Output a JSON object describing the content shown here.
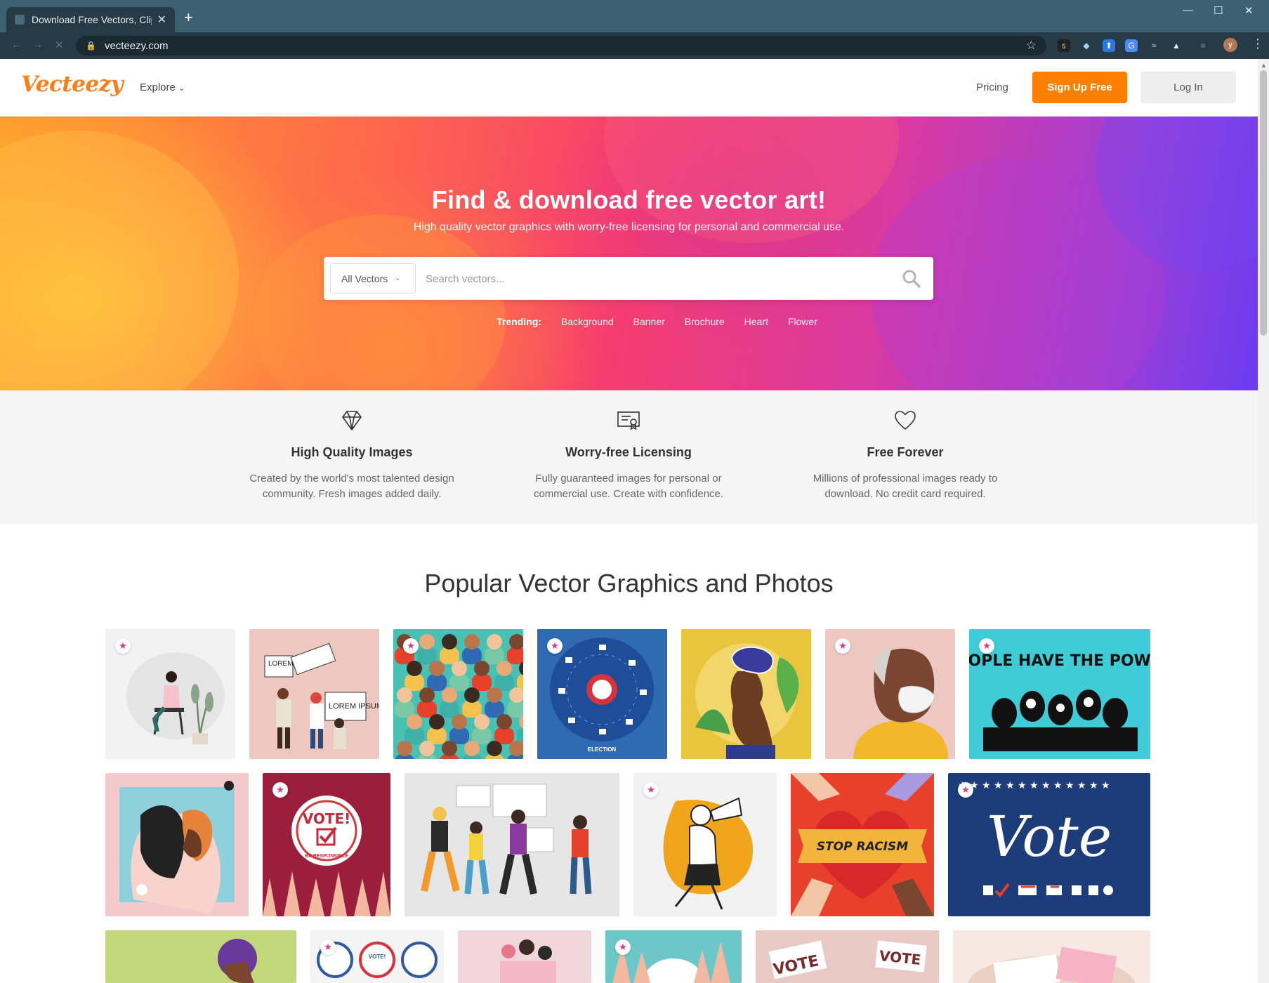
{
  "browser": {
    "tab_title": "Download Free Vectors, Clipar",
    "url": "vecteezy.com",
    "new_tab": "+",
    "tab_close": "✕",
    "profile_initial": "y",
    "window_controls": {
      "minimize": "—",
      "maximize": "☐",
      "close": "✕"
    },
    "extension_badge": "5",
    "icons": [
      "lock-icon",
      "star-icon",
      "extension-icons",
      "profile-avatar",
      "menu-icon"
    ]
  },
  "header": {
    "logo": "Vecteezy",
    "explore": "Explore",
    "explore_chevron": "⌄",
    "pricing": "Pricing",
    "signup": "Sign Up Free",
    "login": "Log In"
  },
  "hero": {
    "title": "Find & download free vector art!",
    "subtitle": "High quality vector graphics with worry-free licensing for personal and commercial use.",
    "search": {
      "category": "All Vectors",
      "placeholder": "Search vectors..."
    },
    "trending_label": "Trending:",
    "trending": [
      "Background",
      "Banner",
      "Brochure",
      "Heart",
      "Flower"
    ]
  },
  "features": [
    {
      "icon": "diamond-icon",
      "title": "High Quality Images",
      "text": "Created by the world's most talented design community. Fresh images added daily."
    },
    {
      "icon": "certificate-icon",
      "title": "Worry-free Licensing",
      "text": "Fully guaranteed images for personal or commercial use. Create with confidence."
    },
    {
      "icon": "heart-icon",
      "title": "Free Forever",
      "text": "Millions of professional images ready to download. No credit card required."
    }
  ],
  "gallery": {
    "title": "Popular Vector Graphics and Photos",
    "tile_text": {
      "lorem": "LOREM IPSUM",
      "election": "ELECTION",
      "people_power": "PEOPLE HAVE THE POWER",
      "vote_badge": "VOTE!",
      "be_responsible": "BE RESPONSIBLE",
      "stop_racism": "STOP RACISM",
      "vote_script": "Vote",
      "vote_sign": "VOTE",
      "vote_small": "VOTE!"
    },
    "colors": {
      "teal": "#3fcbd8",
      "blue": "#2f6ab3",
      "yellow": "#e8c53c",
      "navy": "#1d3c7a",
      "red": "#e8412b",
      "brand": "#ff7f00"
    }
  }
}
